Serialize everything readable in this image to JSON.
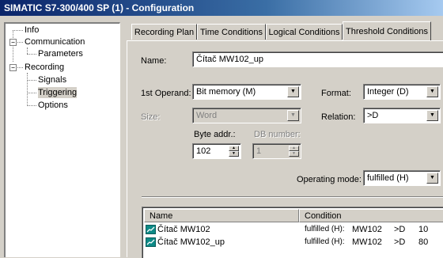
{
  "window": {
    "title": "SIMATIC S7-300/400 SP (1) - Configuration"
  },
  "tree": {
    "info": "Info",
    "communication": "Communication",
    "parameters": "Parameters",
    "recording": "Recording",
    "signals": "Signals",
    "triggering": "Triggering",
    "options": "Options"
  },
  "tabs": {
    "recording_plan": "Recording Plan",
    "time_conditions": "Time Conditions",
    "logical_conditions": "Logical Conditions",
    "threshold_conditions": "Threshold Conditions"
  },
  "form": {
    "name_label": "Name:",
    "name_value": "Čítač MW102_up",
    "operand_label": "1st Operand:",
    "operand_value": "Bit memory (M)",
    "format_label": "Format:",
    "format_value": "Integer (D)",
    "size_label": "Size:",
    "size_value": "Word",
    "relation_label": "Relation:",
    "relation_value": ">D",
    "byte_addr_label": "Byte addr.:",
    "byte_addr_value": "102",
    "db_number_label": "DB number:",
    "db_number_value": "1",
    "mode_label": "Operating mode:",
    "mode_value": "fulfilled (H)"
  },
  "conditions_table": {
    "col_name": "Name",
    "col_condition": "Condition",
    "rows": [
      {
        "name": "Čítač MW102",
        "mode": "fulfilled (H):",
        "operand": "MW102",
        "relation": ">D",
        "value": "10"
      },
      {
        "name": "Čítač MW102_up",
        "mode": "fulfilled (H):",
        "operand": "MW102",
        "relation": ">D",
        "value": "80"
      }
    ]
  },
  "icons": {
    "row_icon": "threshold-condition-icon",
    "row_icon_color": "#0e8a87"
  }
}
